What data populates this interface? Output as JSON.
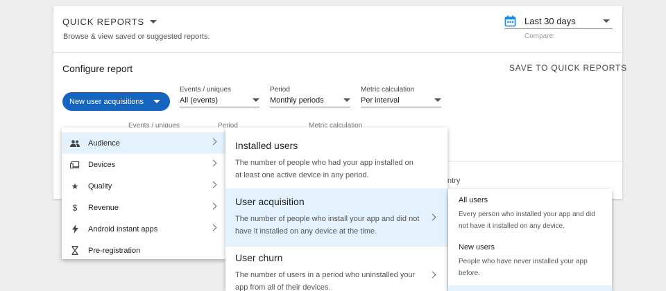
{
  "header": {
    "title": "QUICK REPORTS",
    "subtitle": "Browse & view saved or suggested reports.",
    "date_range": "Last 30 days",
    "compare_label": "Compare:"
  },
  "configure": {
    "title": "Configure report",
    "save_label": "SAVE TO QUICK REPORTS",
    "report_button": "New user acquisitions",
    "selects": [
      {
        "label": "Events / uniques",
        "value": "All (events)"
      },
      {
        "label": "Period",
        "value": "Monthly periods"
      },
      {
        "label": "Metric calculation",
        "value": "Per interval"
      }
    ],
    "ghost_labels": [
      "Events / uniques",
      "Period",
      "Metric calculation"
    ],
    "ghost_country": "ntry"
  },
  "menu_categories": [
    {
      "label": "Audience",
      "icon": "people-icon"
    },
    {
      "label": "Devices",
      "icon": "devices-icon"
    },
    {
      "label": "Quality",
      "icon": "star-icon"
    },
    {
      "label": "Revenue",
      "icon": "dollar-icon"
    },
    {
      "label": "Android instant apps",
      "icon": "bolt-icon"
    },
    {
      "label": "Pre-registration",
      "icon": "hourglass-icon"
    }
  ],
  "menu_metrics": [
    {
      "title": "Installed users",
      "desc": "The number of people who had your app installed on at least one active device in any period."
    },
    {
      "title": "User acquisition",
      "desc": "The number of people who install your app and did not have it installed on any device at the time."
    },
    {
      "title": "User churn",
      "desc": "The number of users in a period who uninstalled your app from all of their devices."
    }
  ],
  "menu_options": [
    {
      "title": "All users",
      "desc": "Every person who installed your app and did not have it installed on any device."
    },
    {
      "title": "New users",
      "desc": "People who have never installed your app before."
    }
  ],
  "colors": {
    "accent": "#1565c0",
    "highlight": "#e3f2fd",
    "calendar": "#1e88e5"
  }
}
